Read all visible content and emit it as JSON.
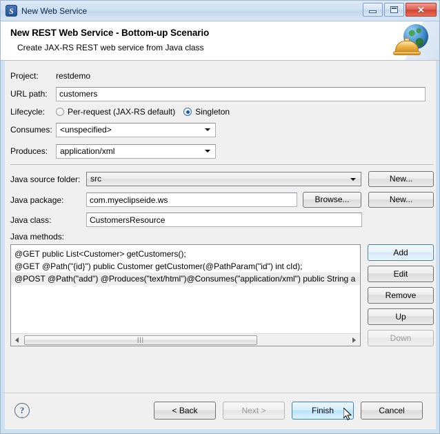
{
  "window": {
    "title": "New Web Service",
    "icon": "myeclipse-s-icon",
    "controls": {
      "minimize": "minimize",
      "maximize": "maximize",
      "close": "close"
    }
  },
  "banner": {
    "title": "New REST Web Service - Bottom-up Scenario",
    "subtitle": "Create JAX-RS REST web service from Java class",
    "artwork": "globe-and-service-bell-icon"
  },
  "form": {
    "project": {
      "label": "Project:",
      "value": "restdemo"
    },
    "url_path": {
      "label": "URL path:",
      "value": "customers"
    },
    "lifecycle": {
      "label": "Lifecycle:",
      "options": [
        {
          "label": "Per-request (JAX-RS default)",
          "selected": false
        },
        {
          "label": "Singleton",
          "selected": true
        }
      ]
    },
    "consumes": {
      "label": "Consumes:",
      "value": "<unspecified>"
    },
    "produces": {
      "label": "Produces:",
      "value": "application/xml"
    },
    "java_source_folder": {
      "label": "Java source folder:",
      "value": "src",
      "button": "New..."
    },
    "java_package": {
      "label": "Java package:",
      "value": "com.myeclipseide.ws",
      "browse_button": "Browse...",
      "new_button": "New..."
    },
    "java_class": {
      "label": "Java class:",
      "value": "CustomersResource"
    },
    "java_methods": {
      "label": "Java methods:",
      "items": [
        {
          "text": "@GET  public List<Customer> getCustomers();",
          "selected": false
        },
        {
          "text": "@GET @Path(\"{id}\") public Customer getCustomer(@PathParam(\"id\") int cId);",
          "selected": false
        },
        {
          "text": "@POST @Path(\"add\") @Produces(\"text/html\")@Consumes(\"application/xml\") public String a",
          "selected": true
        }
      ],
      "buttons": [
        {
          "label": "Add",
          "state": "focused"
        },
        {
          "label": "Edit",
          "state": "normal"
        },
        {
          "label": "Remove",
          "state": "normal"
        },
        {
          "label": "Up",
          "state": "normal"
        },
        {
          "label": "Down",
          "state": "disabled"
        }
      ]
    }
  },
  "footer": {
    "help": "?",
    "buttons": [
      {
        "label": "< Back",
        "state": "normal"
      },
      {
        "label": "Next >",
        "state": "disabled"
      },
      {
        "label": "Finish",
        "state": "hover"
      },
      {
        "label": "Cancel",
        "state": "normal"
      }
    ]
  },
  "colors": {
    "window_border": "#9fb6cd",
    "panel": "#f0f0f0",
    "accent_blue": "#3c7fb1",
    "close_red": "#cf4230",
    "rail": "#cfe0f0"
  }
}
